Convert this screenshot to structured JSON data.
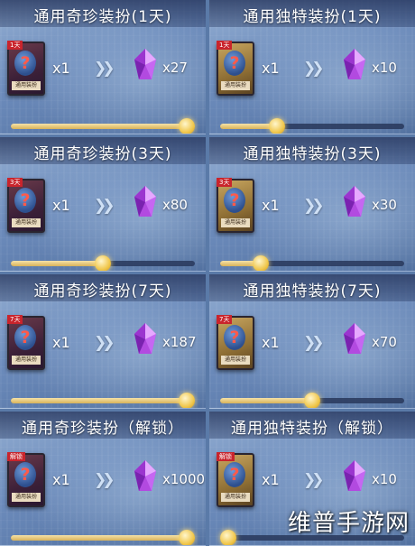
{
  "panels": [
    {
      "title": "通用奇珍装扮(1天)",
      "card_type": "rare",
      "card_tag": "1天",
      "card_label": "通用装扮",
      "qty": "x1",
      "reward": "x27",
      "slider_level": 1.0
    },
    {
      "title": "通用独特装扮(1天)",
      "card_type": "unique",
      "card_tag": "1天",
      "card_label": "通用装扮",
      "qty": "x1",
      "reward": "x10",
      "slider_level": 0.31
    },
    {
      "title": "通用奇珍装扮(3天)",
      "card_type": "rare",
      "card_tag": "3天",
      "card_label": "通用装扮",
      "qty": "x1",
      "reward": "x80",
      "slider_level": 0.5
    },
    {
      "title": "通用独特装扮(3天)",
      "card_type": "unique",
      "card_tag": "3天",
      "card_label": "通用装扮",
      "qty": "x1",
      "reward": "x30",
      "slider_level": 0.22
    },
    {
      "title": "通用奇珍装扮(7天)",
      "card_type": "rare",
      "card_tag": "7天",
      "card_label": "通用装扮",
      "qty": "x1",
      "reward": "x187",
      "slider_level": 1.0
    },
    {
      "title": "通用独特装扮(7天)",
      "card_type": "unique",
      "card_tag": "7天",
      "card_label": "通用装扮",
      "qty": "x1",
      "reward": "x70",
      "slider_level": 0.5
    },
    {
      "title": "通用奇珍装扮（解锁）",
      "card_type": "rare",
      "card_tag": "解锁",
      "card_label": "通用装扮",
      "qty": "x1",
      "reward": "x1000",
      "slider_level": 1.0
    },
    {
      "title": "通用独特装扮（解锁）",
      "card_type": "unique",
      "card_tag": "解锁",
      "card_label": "通用装扮",
      "qty": "x1",
      "reward": "x10",
      "slider_level": 0.0
    }
  ],
  "icons": {
    "card": "mystery-card-icon",
    "arrows": "double-chevron-right-icon",
    "reward": "purple-crystal-icon"
  },
  "colors": {
    "accent_gold": "#f0c64a",
    "crystal_purple": "#b24ae0",
    "panel_blue": "#6c8bbb"
  },
  "watermark": "维普手游网"
}
